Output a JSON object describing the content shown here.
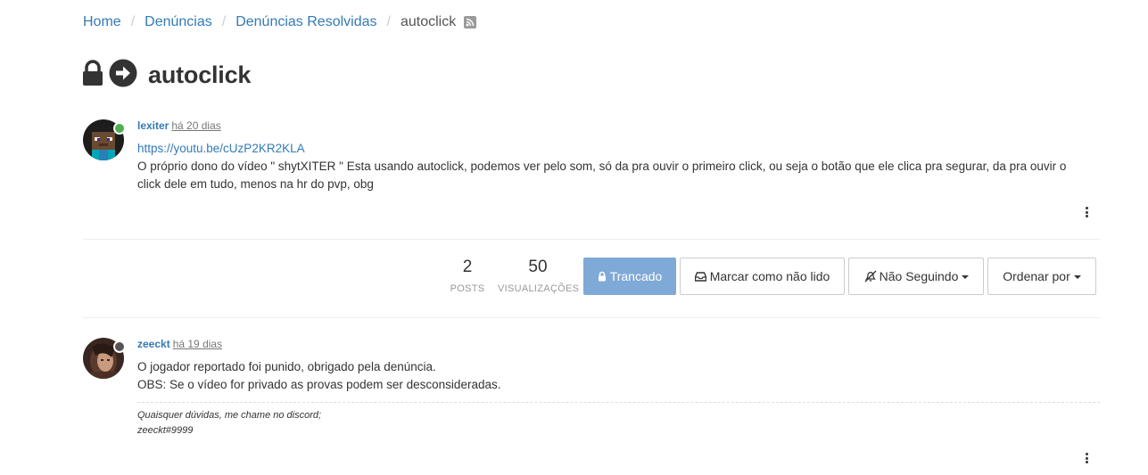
{
  "breadcrumb": {
    "home": "Home",
    "denuncias": "Denúncias",
    "resolvidas": "Denúncias Resolvidas",
    "current": "autoclick"
  },
  "topic": {
    "title": "autoclick",
    "icons": [
      "lock-icon",
      "arrow-right-circle-icon"
    ]
  },
  "posts": [
    {
      "author": "lexiter",
      "time": "há 20 dias",
      "status": "online",
      "link": "https://youtu.be/cUzP2KR2KLA",
      "line1": "O próprio dono do vídeo \" shytXITER \" Esta usando autoclick, podemos ver pelo som, só da pra ouvir o primeiro click, ou seja o botão que ele clica pra segurar, da pra ouvir o",
      "line2": "click dele em tudo, menos na hr do pvp, obg"
    },
    {
      "author": "zeeckt",
      "time": "há 19 dias",
      "status": "away",
      "line1": "O jogador reportado foi punido, obrigado pela denúncia.",
      "line2": "OBS: Se o vídeo for privado as provas podem ser desconsideradas.",
      "signature1": "Quaisquer dúvidas, me chame no discord;",
      "signature2": "zeeckt#9999"
    }
  ],
  "stats": {
    "posts_value": "2",
    "posts_label": "POSTS",
    "views_value": "50",
    "views_label": "VISUALIZAÇÕES"
  },
  "toolbar": {
    "locked_label": "Trancado",
    "mark_unread_label": "Marcar como não lido",
    "follow_label": "Não Seguindo",
    "sort_label": "Ordenar por"
  },
  "colors": {
    "link": "#337ab7",
    "locked_button": "#7fa9d6",
    "online": "#4caf50"
  }
}
